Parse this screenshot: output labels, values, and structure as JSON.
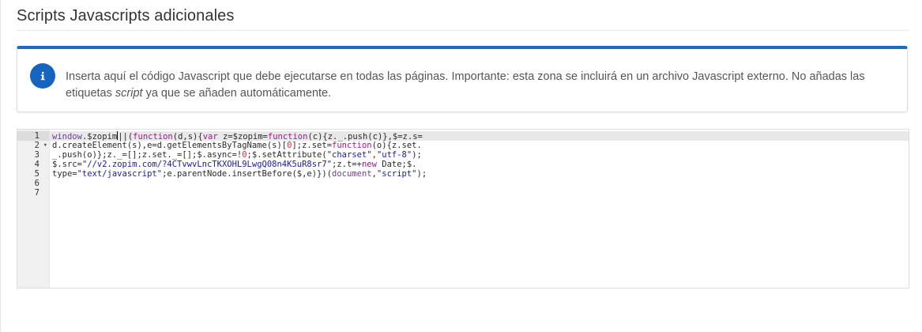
{
  "section": {
    "title": "Scripts Javascripts adicionales"
  },
  "info": {
    "icon": "info-icon",
    "text_before": "Inserta aquí el código Javascript que debe ejecutarse en todas las páginas. Importante: esta zona se incluirá en un archivo Javascript externo. No añadas las etiquetas ",
    "text_em": "script",
    "text_after": " ya que se añaden automáticamente.",
    "accent_color": "#1e6bbd"
  },
  "editor": {
    "line_numbers": [
      "1",
      "2",
      "3",
      "4",
      "5",
      "6",
      "7"
    ],
    "lines": [
      "window.$zopim||(function(d,s){var z=$zopim=function(c){z._.push(c)},$=z.s=",
      "d.createElement(s),e=d.getElementsByTagName(s)[0];z.set=function(o){z.set.",
      "_.push(o)};z._=[];z.set._=[];$.async=!0;$.setAttribute(\"charset\",\"utf-8\");",
      "$.src=\"//v2.zopim.com/?4CTvwvLncTKXOHL9LwgQ08n4K5uR8sr7\";z.t=+new Date;$.",
      "type=\"text/javascript\";e.parentNode.insertBefore($,e)})(document,\"script\");",
      "",
      ""
    ]
  }
}
